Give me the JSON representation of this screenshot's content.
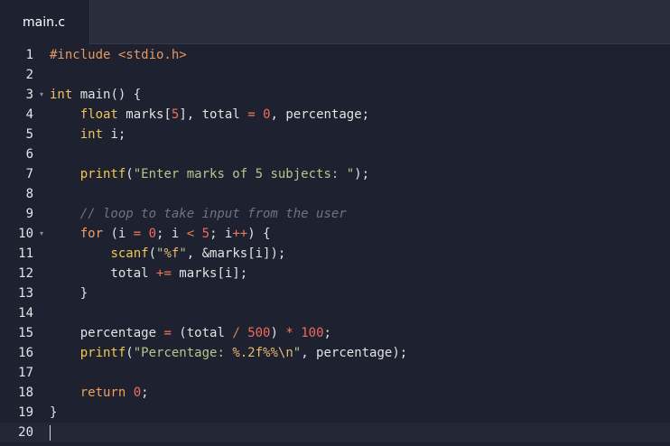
{
  "tabs": [
    {
      "label": "main.c",
      "active": true
    }
  ],
  "editor": {
    "active_line": 20,
    "colors": {
      "background": "#1d2130",
      "tabbar": "#2a2e3c",
      "keyword": "#f0a05a",
      "type": "#f0c55a",
      "function": "#f2c94c",
      "string": "#b5c88a",
      "number": "#f26b5b",
      "operator": "#f07a55",
      "comment": "#6e7487"
    },
    "lines": [
      {
        "number": "1",
        "fold": false,
        "tokens": [
          {
            "t": "#include ",
            "c": "include"
          },
          {
            "t": "<stdio.h>",
            "c": "include"
          }
        ]
      },
      {
        "number": "2",
        "fold": false,
        "tokens": []
      },
      {
        "number": "3",
        "fold": true,
        "tokens": [
          {
            "t": "int",
            "c": "type"
          },
          {
            "t": " main() {",
            "c": "default"
          }
        ]
      },
      {
        "number": "4",
        "fold": false,
        "tokens": [
          {
            "t": "    ",
            "c": "default"
          },
          {
            "t": "float",
            "c": "type"
          },
          {
            "t": " marks[",
            "c": "default"
          },
          {
            "t": "5",
            "c": "number"
          },
          {
            "t": "], total ",
            "c": "default"
          },
          {
            "t": "=",
            "c": "op"
          },
          {
            "t": " ",
            "c": "default"
          },
          {
            "t": "0",
            "c": "number"
          },
          {
            "t": ", percentage;",
            "c": "default"
          }
        ]
      },
      {
        "number": "5",
        "fold": false,
        "tokens": [
          {
            "t": "    ",
            "c": "default"
          },
          {
            "t": "int",
            "c": "type"
          },
          {
            "t": " i;",
            "c": "default"
          }
        ]
      },
      {
        "number": "6",
        "fold": false,
        "tokens": []
      },
      {
        "number": "7",
        "fold": false,
        "tokens": [
          {
            "t": "    ",
            "c": "default"
          },
          {
            "t": "printf",
            "c": "func"
          },
          {
            "t": "(",
            "c": "default"
          },
          {
            "t": "\"Enter marks of 5 subjects: \"",
            "c": "string"
          },
          {
            "t": ");",
            "c": "default"
          }
        ]
      },
      {
        "number": "8",
        "fold": false,
        "tokens": []
      },
      {
        "number": "9",
        "fold": false,
        "tokens": [
          {
            "t": "    ",
            "c": "default"
          },
          {
            "t": "// loop to take input from the user",
            "c": "comment"
          }
        ]
      },
      {
        "number": "10",
        "fold": true,
        "tokens": [
          {
            "t": "    ",
            "c": "default"
          },
          {
            "t": "for",
            "c": "keyword"
          },
          {
            "t": " (i ",
            "c": "default"
          },
          {
            "t": "=",
            "c": "op"
          },
          {
            "t": " ",
            "c": "default"
          },
          {
            "t": "0",
            "c": "number"
          },
          {
            "t": "; i ",
            "c": "default"
          },
          {
            "t": "<",
            "c": "op"
          },
          {
            "t": " ",
            "c": "default"
          },
          {
            "t": "5",
            "c": "number"
          },
          {
            "t": "; i",
            "c": "default"
          },
          {
            "t": "++",
            "c": "op"
          },
          {
            "t": ") {",
            "c": "default"
          }
        ]
      },
      {
        "number": "11",
        "fold": false,
        "tokens": [
          {
            "t": "        ",
            "c": "default"
          },
          {
            "t": "scanf",
            "c": "func"
          },
          {
            "t": "(",
            "c": "default"
          },
          {
            "t": "\"",
            "c": "string"
          },
          {
            "t": "%f",
            "c": "format"
          },
          {
            "t": "\"",
            "c": "string"
          },
          {
            "t": ", &marks[i]);",
            "c": "default"
          }
        ]
      },
      {
        "number": "12",
        "fold": false,
        "tokens": [
          {
            "t": "        total ",
            "c": "default"
          },
          {
            "t": "+=",
            "c": "op"
          },
          {
            "t": " marks[i];",
            "c": "default"
          }
        ]
      },
      {
        "number": "13",
        "fold": false,
        "tokens": [
          {
            "t": "    }",
            "c": "default"
          }
        ]
      },
      {
        "number": "14",
        "fold": false,
        "tokens": []
      },
      {
        "number": "15",
        "fold": false,
        "tokens": [
          {
            "t": "    percentage ",
            "c": "default"
          },
          {
            "t": "=",
            "c": "op"
          },
          {
            "t": " (total ",
            "c": "default"
          },
          {
            "t": "/",
            "c": "op"
          },
          {
            "t": " ",
            "c": "default"
          },
          {
            "t": "500",
            "c": "number"
          },
          {
            "t": ") ",
            "c": "default"
          },
          {
            "t": "*",
            "c": "op"
          },
          {
            "t": " ",
            "c": "default"
          },
          {
            "t": "100",
            "c": "number"
          },
          {
            "t": ";",
            "c": "default"
          }
        ]
      },
      {
        "number": "16",
        "fold": false,
        "tokens": [
          {
            "t": "    ",
            "c": "default"
          },
          {
            "t": "printf",
            "c": "func"
          },
          {
            "t": "(",
            "c": "default"
          },
          {
            "t": "\"Percentage: ",
            "c": "string"
          },
          {
            "t": "%.2f%%\\n",
            "c": "format"
          },
          {
            "t": "\"",
            "c": "string"
          },
          {
            "t": ", percentage);",
            "c": "default"
          }
        ]
      },
      {
        "number": "17",
        "fold": false,
        "tokens": []
      },
      {
        "number": "18",
        "fold": false,
        "tokens": [
          {
            "t": "    ",
            "c": "default"
          },
          {
            "t": "return",
            "c": "keyword"
          },
          {
            "t": " ",
            "c": "default"
          },
          {
            "t": "0",
            "c": "number"
          },
          {
            "t": ";",
            "c": "default"
          }
        ]
      },
      {
        "number": "19",
        "fold": false,
        "tokens": [
          {
            "t": "}",
            "c": "default"
          }
        ]
      },
      {
        "number": "20",
        "fold": false,
        "tokens": []
      }
    ]
  }
}
